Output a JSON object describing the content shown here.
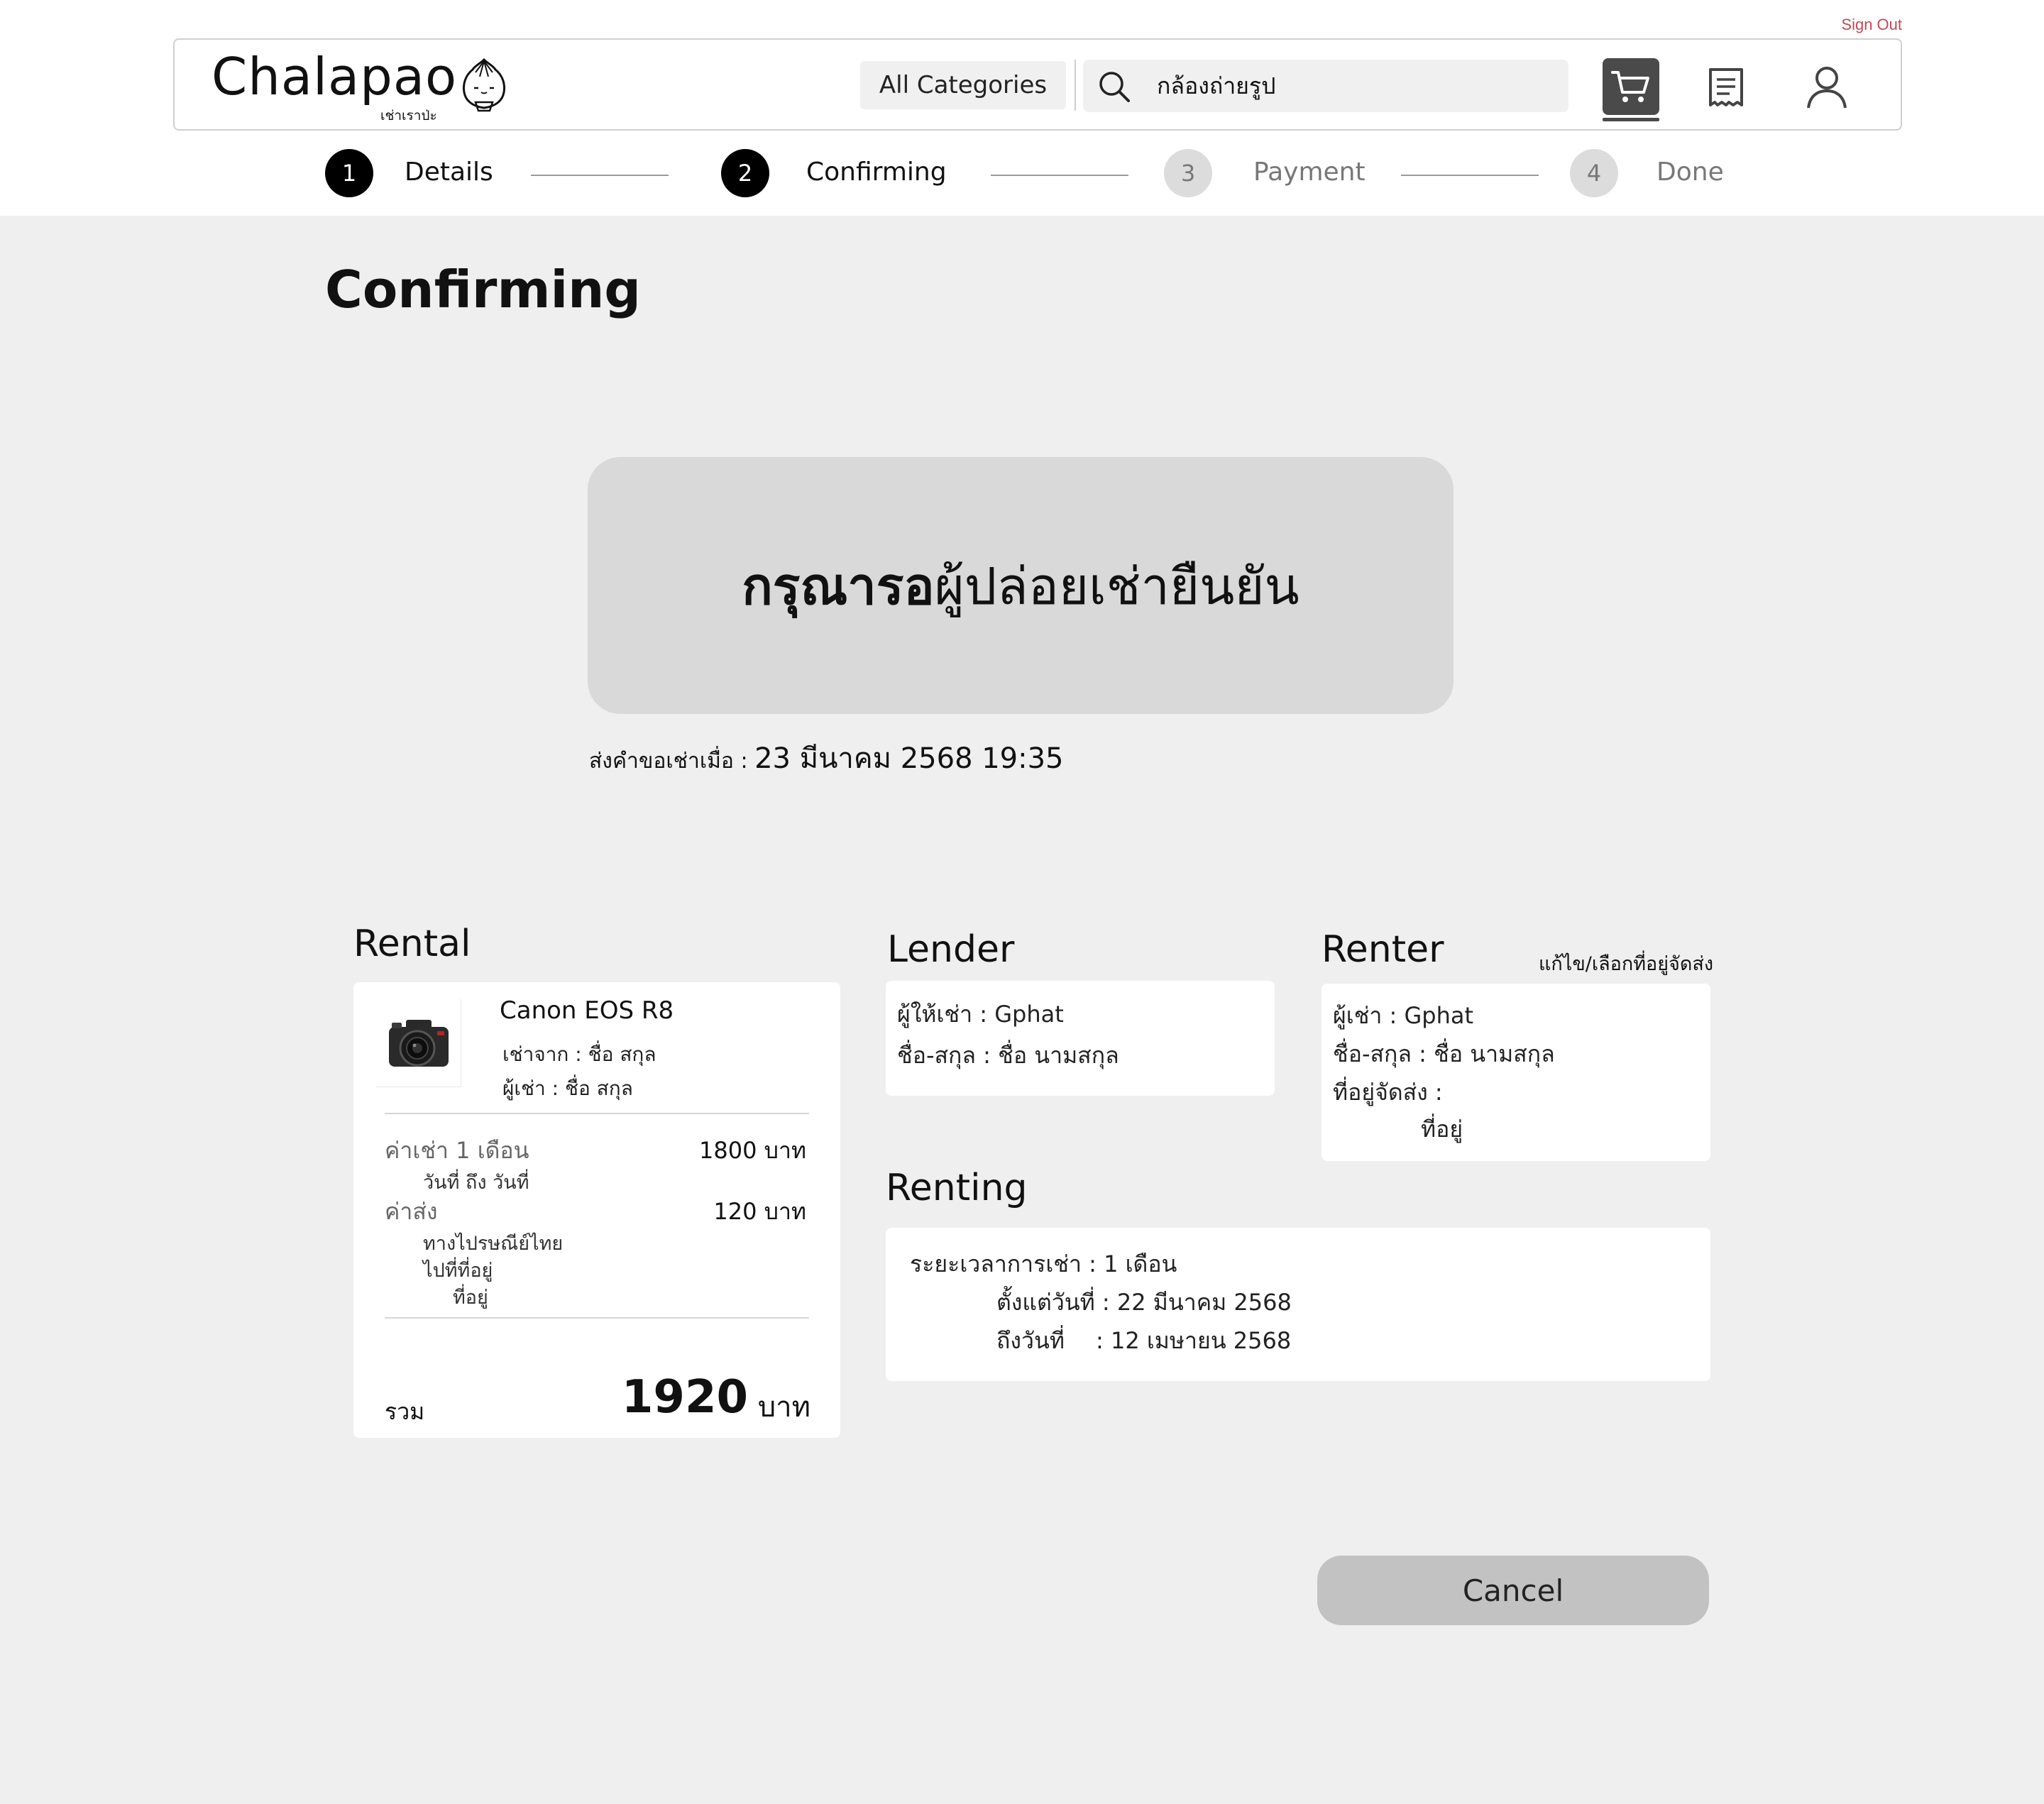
{
  "header": {
    "sign_out": "Sign Out",
    "logo": "Chalapao",
    "logo_sub": "เช่าเราป่ะ",
    "all_categories": "All Categories",
    "search_value": "กล้องถ่ายรูป",
    "icons": [
      "search-icon",
      "cart-icon",
      "receipt-icon",
      "user-icon"
    ]
  },
  "steps": [
    {
      "num": "1",
      "label": "Details",
      "state": "done"
    },
    {
      "num": "2",
      "label": "Confirming",
      "state": "current"
    },
    {
      "num": "3",
      "label": "Payment",
      "state": "pending"
    },
    {
      "num": "4",
      "label": "Done",
      "state": "pending"
    }
  ],
  "page_title": "Confirming",
  "wait": {
    "bold": "กรุณารอ",
    "rest": "ผู้ปล่อยเช่ายืนยัน"
  },
  "sent": {
    "label": "ส่งคำขอเช่าเมื่อ : ",
    "datetime": "23 มีนาคม 2568 19:35"
  },
  "rental": {
    "title": "Rental",
    "product": "Canon EOS R8",
    "from": "เช่าจาก : ชื่อ สกุล",
    "renter": "ผู้เช่า : ชื่อ สกุล",
    "fee_label": "ค่าเช่า 1 เดือน",
    "fee_dates": "วันที่ ถึง วันที่",
    "fee_value": "1800 บาท",
    "ship_label": "ค่าส่ง",
    "ship_method": "ทางไปรษณีย์ไทย",
    "ship_to": "ไปที่ที่อยู่",
    "ship_addr": "ที่อยู่",
    "ship_value": "120 บาท",
    "total_label": "รวม",
    "total_value": "1920",
    "total_unit": "บาท"
  },
  "lender": {
    "title": "Lender",
    "username": "ผู้ให้เช่า : Gphat",
    "fullname": "ชื่อ-สกุล :  ชื่อ  นามสกุล"
  },
  "renter": {
    "title": "Renter",
    "edit_link": "แก้ไข/เลือกที่อยู่จัดส่ง",
    "username": "ผู้เช่า : Gphat",
    "fullname": "ชื่อ-สกุล :  ชื่อ  นามสกุล",
    "address_label": "ที่อยู่จัดส่ง :",
    "address": "ที่อยู่"
  },
  "renting": {
    "title": "Renting",
    "duration": "ระยะเวลาการเช่า : 1 เดือน",
    "start": "ตั้งแต่วันที่ : 22 มีนาคม 2568",
    "end_label": "ถึงวันที่",
    "end": ": 12 เมษายน 2568"
  },
  "cancel": "Cancel",
  "colors": {
    "active_step": "#000000",
    "inactive_step": "#dcdcdc",
    "sign_out": "#c04a57",
    "cart_bg": "#4a4a4a",
    "wait_box": "#d9d9d9",
    "cancel_btn": "#c2c2c2"
  }
}
